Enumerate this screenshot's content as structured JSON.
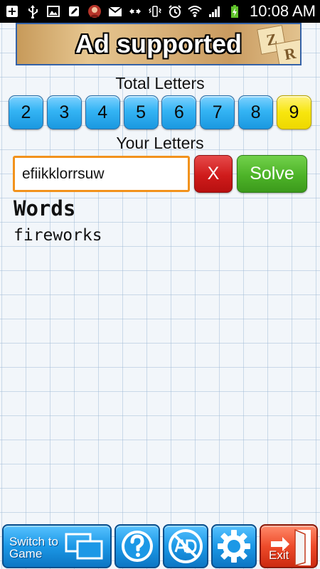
{
  "status_bar": {
    "time": "10:08 AM"
  },
  "ad_banner": {
    "text": "Ad supported",
    "tiles": [
      "Z",
      "R"
    ]
  },
  "total_letters": {
    "label": "Total Letters",
    "options": [
      "2",
      "3",
      "4",
      "5",
      "6",
      "7",
      "8",
      "9"
    ],
    "selected": "9"
  },
  "your_letters": {
    "label": "Your Letters",
    "value": "efiikklorrsuw",
    "clear_label": "X",
    "solve_label": "Solve"
  },
  "results": {
    "heading": "Words",
    "words": [
      "fireworks"
    ]
  },
  "toolbar": {
    "switch_line1": "Switch to",
    "switch_line2": "Game",
    "exit_label": "Exit"
  },
  "colors": {
    "number_button": "#1a98e0",
    "selected_number_button": "#f7e60e",
    "input_border": "#f2921c",
    "clear_button": "#cf1b1b",
    "solve_button": "#4db328",
    "toolbar_button": "#1c98e6",
    "exit_button": "#ee4b2a"
  }
}
